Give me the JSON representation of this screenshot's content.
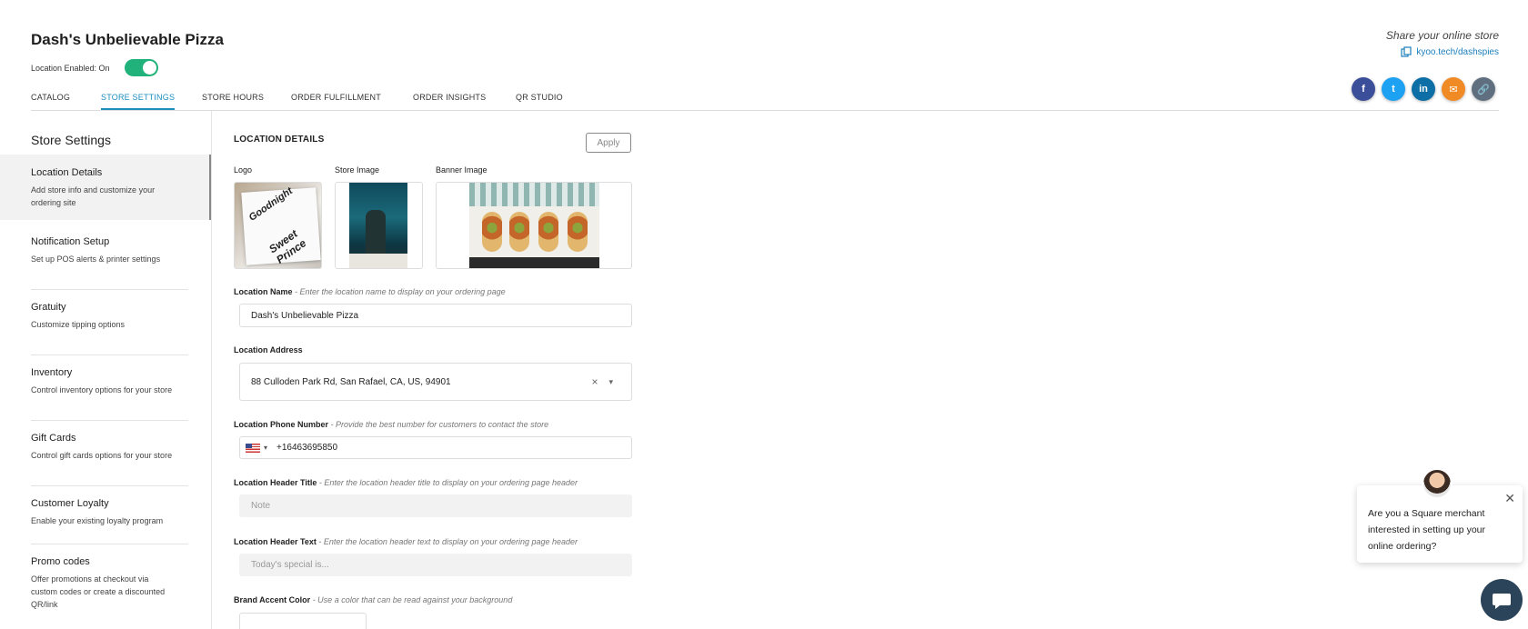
{
  "header": {
    "store_name": "Dash's Unbelievable Pizza",
    "location_enabled_label": "Location Enabled: On",
    "location_enabled": true,
    "tabs": [
      {
        "label": "CATALOG",
        "active": false
      },
      {
        "label": "STORE SETTINGS",
        "active": true
      },
      {
        "label": "STORE HOURS",
        "active": false
      },
      {
        "label": "ORDER FULFILLMENT",
        "active": false
      },
      {
        "label": "ORDER INSIGHTS",
        "active": false
      },
      {
        "label": "QR STUDIO",
        "active": false
      }
    ],
    "share_label": "Share your online store",
    "share_link": "kyoo.tech/dashspies",
    "socials": [
      {
        "name": "facebook-icon",
        "glyph": "f",
        "color": "#3b4e9a"
      },
      {
        "name": "twitter-icon",
        "glyph": "t",
        "color": "#1da1f2"
      },
      {
        "name": "linkedin-icon",
        "glyph": "in",
        "color": "#0e6fa6"
      },
      {
        "name": "email-icon",
        "glyph": "✉",
        "color": "#f08a24"
      },
      {
        "name": "link-icon",
        "glyph": "🔗",
        "color": "#5f6f7f"
      }
    ]
  },
  "sidebar": {
    "title": "Store Settings",
    "items": [
      {
        "title": "Location Details",
        "desc": "Add store info and customize your ordering site",
        "active": true
      },
      {
        "title": "Notification Setup",
        "desc": "Set up POS alerts & printer settings",
        "active": false
      },
      {
        "title": "Gratuity",
        "desc": "Customize tipping options",
        "active": false
      },
      {
        "title": "Inventory",
        "desc": "Control inventory options for your store",
        "active": false
      },
      {
        "title": "Gift Cards",
        "desc": "Control gift cards options for your store",
        "active": false
      },
      {
        "title": "Customer Loyalty",
        "desc": "Enable your existing loyalty program",
        "active": false
      },
      {
        "title": "Promo codes",
        "desc": "Offer promotions at checkout via custom codes or create a discounted QR/link",
        "active": false
      }
    ]
  },
  "main": {
    "section_title": "LOCATION DETAILS",
    "apply_label": "Apply",
    "images": {
      "logo_label": "Logo",
      "logo_text_1": "Goodnight",
      "logo_text_2": "Sweet Prince",
      "store_label": "Store Image",
      "banner_label": "Banner Image"
    },
    "location_name": {
      "label": "Location Name",
      "hint": " - Enter the location name to display on your ordering page",
      "value": "Dash's Unbelievable Pizza"
    },
    "location_address": {
      "label": "Location Address",
      "value": "88 Culloden Park Rd, San Rafael, CA, US, 94901",
      "clear_glyph": "×",
      "dropdown_glyph": "▾"
    },
    "phone": {
      "label": "Location Phone Number",
      "hint": " - Provide the best number for customers to contact the store",
      "value": "+16463695850",
      "dropdown_glyph": "▾"
    },
    "header_title": {
      "label": "Location Header Title",
      "hint": " - Enter the location header title to display on your ordering page header",
      "placeholder": "Note"
    },
    "header_text": {
      "label": "Location Header Text",
      "hint": " - Enter the location header text to display on your ordering page header",
      "placeholder": "Today's special is..."
    },
    "brand_color": {
      "label": "Brand Accent Color",
      "hint": " - Use a color that can be read against your background"
    }
  },
  "chat": {
    "message": "Are you a Square merchant interested in setting up your online ordering?",
    "close_glyph": "✕"
  }
}
